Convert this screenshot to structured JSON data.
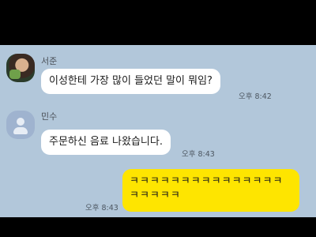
{
  "messages": [
    {
      "sender": "서준",
      "text": "이성한테 가장 많이 들었던 말이 뭐임?",
      "time": "오후 8:42"
    },
    {
      "sender": "민수",
      "text": "주문하신 음료 나왔습니다.",
      "time": "오후 8:43"
    },
    {
      "sender": "",
      "text": "ㅋㅋㅋㅋㅋㅋㅋㅋㅋㅋㅋㅋㅋㅋㅋㅋㅋㅋㅋㅋ",
      "time": "오후 8:43"
    }
  ],
  "colors": {
    "chat_background": "#b2c7da",
    "my_bubble": "#fee500",
    "other_bubble": "#ffffff"
  },
  "icons": [
    "profile-photo",
    "default-profile-icon"
  ]
}
